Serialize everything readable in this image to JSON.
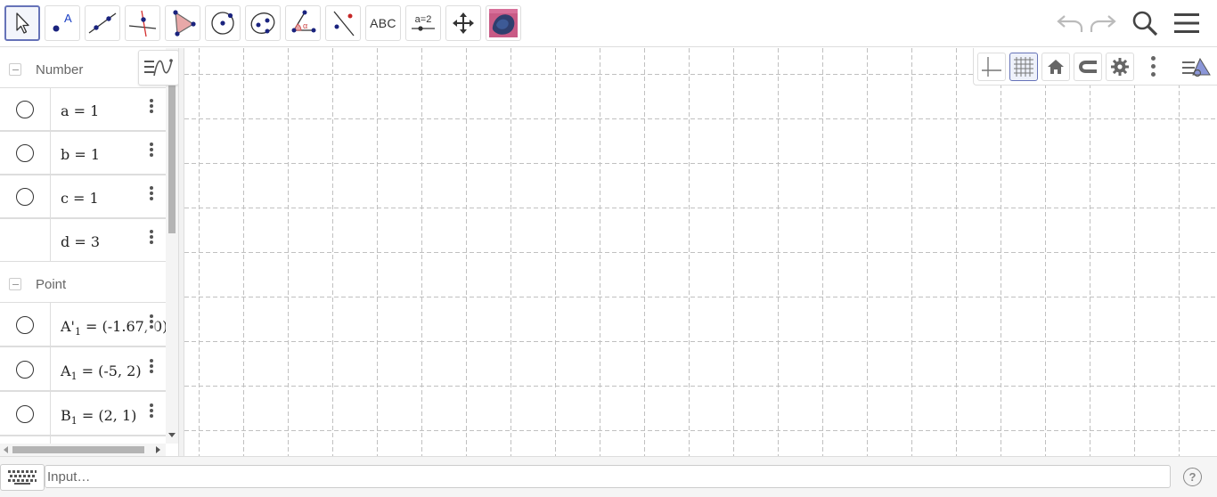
{
  "toolbar": {
    "tools": [
      {
        "name": "move-tool",
        "active": true
      },
      {
        "name": "point-tool"
      },
      {
        "name": "line-tool"
      },
      {
        "name": "perpendicular-line-tool"
      },
      {
        "name": "polygon-tool"
      },
      {
        "name": "circle-tool"
      },
      {
        "name": "ellipse-tool"
      },
      {
        "name": "angle-tool"
      },
      {
        "name": "reflect-tool"
      },
      {
        "name": "text-tool",
        "label": "ABC"
      },
      {
        "name": "slider-tool",
        "label": "a=2"
      },
      {
        "name": "move-graphics-view-tool"
      },
      {
        "name": "image-tool"
      }
    ],
    "right_icons": [
      "undo-icon",
      "redo-icon",
      "search-icon",
      "menu-icon"
    ]
  },
  "algebra": {
    "groups": [
      {
        "label": "Number",
        "items": [
          {
            "expr": "a = 1",
            "marble": true
          },
          {
            "expr": "b = 1",
            "marble": true
          },
          {
            "expr": "c = 1",
            "marble": true
          },
          {
            "expr": "d = 3",
            "marble": false
          }
        ]
      },
      {
        "label": "Point",
        "items": [
          {
            "expr_main": "A'",
            "sub": "1",
            "expr_rest": " = (-1.67, 0)",
            "marble": true
          },
          {
            "expr_main": "A",
            "sub": "1",
            "expr_rest": " = (-5, 2)",
            "marble": true
          },
          {
            "expr_main": "B",
            "sub": "1",
            "expr_rest": " = (2, 1)",
            "marble": true
          }
        ]
      }
    ]
  },
  "style_bar": {
    "buttons": [
      "axes-toggle-icon",
      "grid-toggle-icon",
      "home-icon",
      "magnet-icon",
      "settings-icon",
      "more-options-icon",
      "style-bar-toggle-icon"
    ]
  },
  "input_bar": {
    "placeholder": "Input…",
    "help": "?"
  },
  "colors": {
    "active_tool_border": "#6673b8",
    "grid_line": "#c0c0c0",
    "point_blue": "#1565c0"
  }
}
